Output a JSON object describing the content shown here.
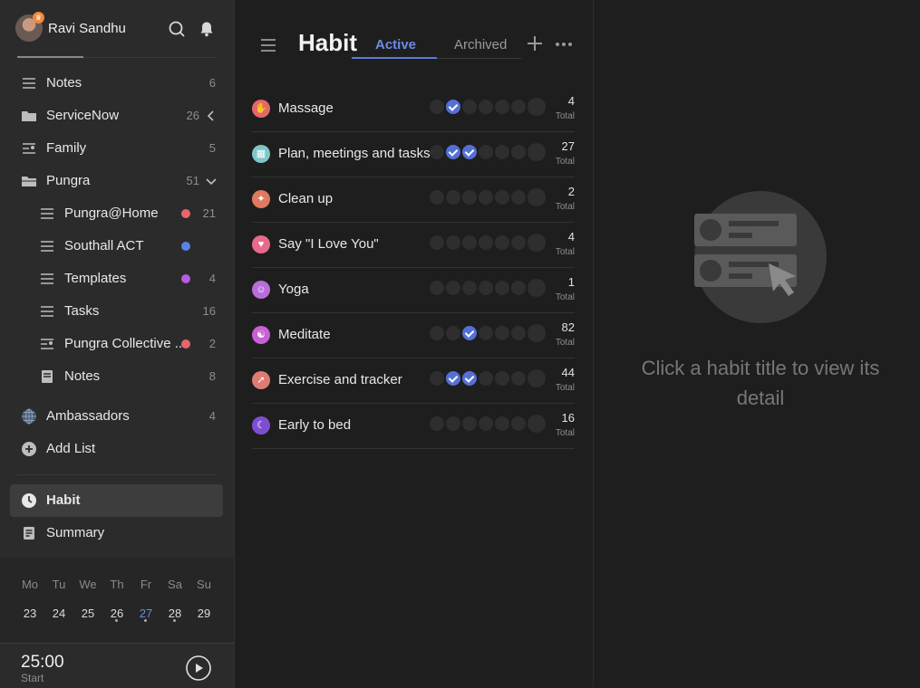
{
  "user": {
    "name": "Ravi Sandhu"
  },
  "sidebar": {
    "items": [
      {
        "label": "Notes",
        "count": "6",
        "icon": "list-icon"
      },
      {
        "label": "ServiceNow",
        "count": "26",
        "icon": "folder-icon"
      },
      {
        "label": "Family",
        "count": "5",
        "icon": "shared-list-icon"
      },
      {
        "label": "Pungra",
        "count": "51",
        "icon": "folder-icon"
      },
      {
        "label": "Pungra@Home",
        "count": "21",
        "icon": "list-icon",
        "dot": "#e5676b"
      },
      {
        "label": "Southall ACT",
        "count": "",
        "icon": "list-icon",
        "dot": "#5b82e6"
      },
      {
        "label": "Templates",
        "count": "4",
        "icon": "list-icon",
        "dot": "#b45ee0"
      },
      {
        "label": "Tasks",
        "count": "16",
        "icon": "list-icon"
      },
      {
        "label": "Pungra Collective ...",
        "count": "2",
        "icon": "shared-list-icon",
        "dot": "#e5676b"
      },
      {
        "label": "Notes",
        "count": "8",
        "icon": "note-icon"
      },
      {
        "label": "Ambassadors",
        "count": "4",
        "icon": "globe-icon"
      }
    ],
    "add_list": "Add List",
    "habit": "Habit",
    "summary": "Summary"
  },
  "calendar": {
    "days": [
      "Mo",
      "Tu",
      "We",
      "Th",
      "Fr",
      "Sa",
      "Su"
    ],
    "dates": [
      "23",
      "24",
      "25",
      "26",
      "27",
      "28",
      "29"
    ],
    "today": "27"
  },
  "timer": {
    "time": "25:00",
    "label": "Start"
  },
  "main": {
    "title": "Habit",
    "tabs": {
      "active": "Active",
      "archived": "Archived"
    },
    "habits": [
      {
        "name": "Massage",
        "total": "4",
        "total_label": "Total",
        "checks": [
          false,
          true,
          false,
          false,
          false,
          false,
          false
        ],
        "icon_color": "#e5676b",
        "icon": "hand-icon"
      },
      {
        "name": "Plan, meetings and tasks",
        "total": "27",
        "total_label": "Total",
        "checks": [
          false,
          true,
          true,
          false,
          false,
          false,
          false
        ],
        "icon_color": "#7fc6c8",
        "icon": "calendar-icon"
      },
      {
        "name": "Clean up",
        "total": "2",
        "total_label": "Total",
        "checks": [
          false,
          false,
          false,
          false,
          false,
          false,
          false
        ],
        "icon_color": "#e07a5f",
        "icon": "broom-icon"
      },
      {
        "name": "Say \"I Love You\"",
        "total": "4",
        "total_label": "Total",
        "checks": [
          false,
          false,
          false,
          false,
          false,
          false,
          false
        ],
        "icon_color": "#e86a8a",
        "icon": "heart-icon"
      },
      {
        "name": "Yoga",
        "total": "1",
        "total_label": "Total",
        "checks": [
          false,
          false,
          false,
          false,
          false,
          false,
          false
        ],
        "icon_color": "#b86ed9",
        "icon": "yoga-icon"
      },
      {
        "name": "Meditate",
        "total": "82",
        "total_label": "Total",
        "checks": [
          false,
          false,
          true,
          false,
          false,
          false,
          false
        ],
        "icon_color": "#c95fd6",
        "icon": "meditate-icon"
      },
      {
        "name": "Exercise and tracker",
        "total": "44",
        "total_label": "Total",
        "checks": [
          false,
          true,
          true,
          false,
          false,
          false,
          false
        ],
        "icon_color": "#e07b74",
        "icon": "run-icon"
      },
      {
        "name": "Early to bed",
        "total": "16",
        "total_label": "Total",
        "checks": [
          false,
          false,
          false,
          false,
          false,
          false,
          false
        ],
        "icon_color": "#7d4fd0",
        "icon": "moon-icon"
      }
    ]
  },
  "detail": {
    "text": "Click a habit title to view its detail"
  }
}
